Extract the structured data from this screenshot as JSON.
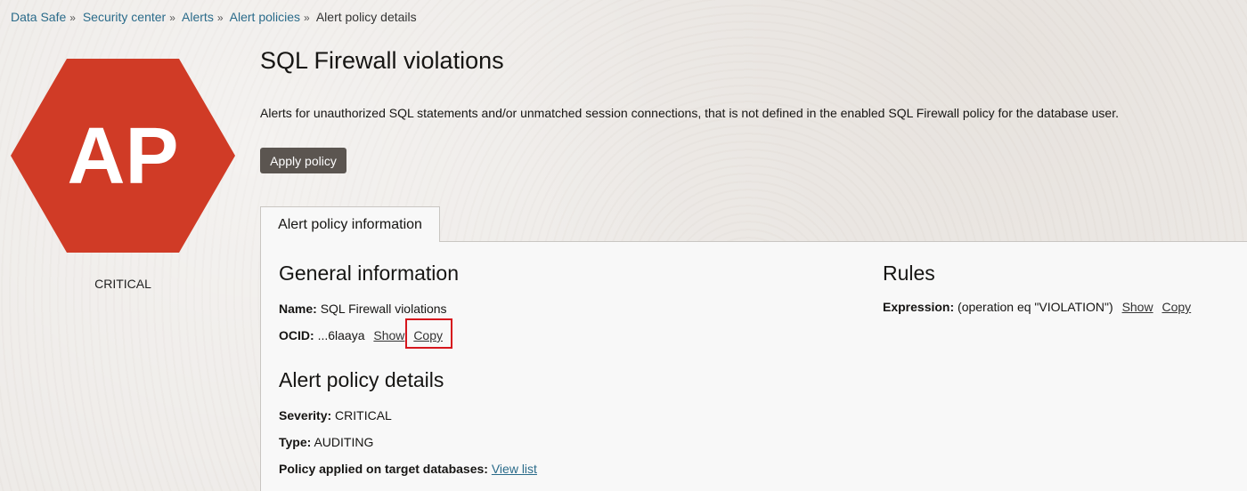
{
  "breadcrumb": {
    "items": [
      {
        "label": "Data Safe"
      },
      {
        "label": "Security center"
      },
      {
        "label": "Alerts"
      },
      {
        "label": "Alert policies"
      }
    ],
    "separator": "»",
    "current": "Alert policy details"
  },
  "badge": {
    "initials": "AP",
    "color": "#d03b26",
    "label": "CRITICAL",
    "icon": "hexagon-icon"
  },
  "header": {
    "title": "SQL Firewall violations",
    "description": "Alerts for unauthorized SQL statements and/or unmatched session connections, that is not defined in the enabled SQL Firewall policy for the database user.",
    "apply_button": "Apply policy"
  },
  "tabs": [
    {
      "label": "Alert policy information",
      "active": true
    }
  ],
  "general_information": {
    "heading": "General information",
    "name_label": "Name:",
    "name_value": "SQL Firewall violations",
    "ocid_label": "OCID:",
    "ocid_value": "...6laaya",
    "show_label": "Show",
    "copy_label": "Copy"
  },
  "alert_policy_details": {
    "heading": "Alert policy details",
    "severity_label": "Severity:",
    "severity_value": "CRITICAL",
    "type_label": "Type:",
    "type_value": "AUDITING",
    "applied_label": "Policy applied on target databases:",
    "applied_link": "View list"
  },
  "rules": {
    "heading": "Rules",
    "expression_label": "Expression:",
    "expression_value": "(operation eq \"VIOLATION\")",
    "show_label": "Show",
    "copy_label": "Copy"
  },
  "colors": {
    "accent_link": "#2a6b8a",
    "button_bg": "#5b5550",
    "highlight": "#d6161d"
  }
}
